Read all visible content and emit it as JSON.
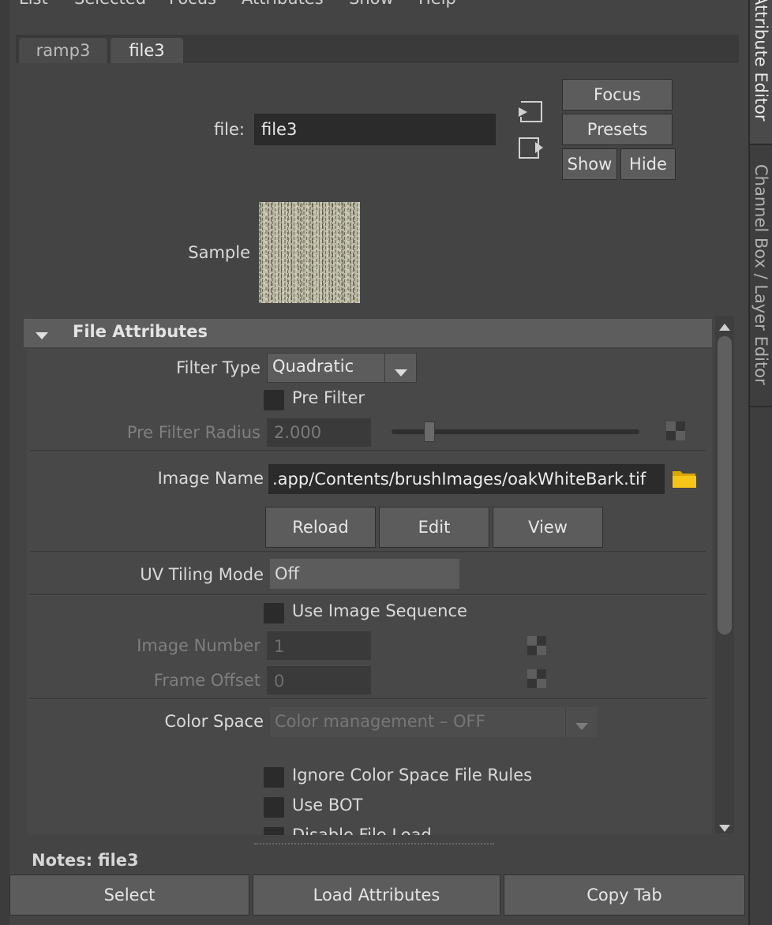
{
  "menubar": [
    "List",
    "Selected",
    "Focus",
    "Attributes",
    "Show",
    "Help"
  ],
  "tabs": [
    {
      "label": "ramp3",
      "active": false
    },
    {
      "label": "file3",
      "active": true
    }
  ],
  "node": {
    "label": "file:",
    "value": "file3"
  },
  "header_buttons": {
    "focus": "Focus",
    "presets": "Presets",
    "show": "Show",
    "hide": "Hide"
  },
  "sample_label": "Sample",
  "section": {
    "title": "File Attributes",
    "expanded": true
  },
  "attrs": {
    "filter_type": {
      "label": "Filter Type",
      "value": "Quadratic"
    },
    "pre_filter": {
      "label": "Pre Filter",
      "checked": false
    },
    "pre_filter_radius": {
      "label": "Pre Filter Radius",
      "value": "2.000",
      "slider_fraction": 0.13
    },
    "image_name": {
      "label": "Image Name",
      "value": ".app/Contents/brushImages/oakWhiteBark.tif"
    },
    "image_buttons": {
      "reload": "Reload",
      "edit": "Edit",
      "view": "View"
    },
    "uv_tiling": {
      "label": "UV Tiling Mode",
      "value": "Off"
    },
    "use_image_sequence": {
      "label": "Use Image Sequence",
      "checked": false
    },
    "image_number": {
      "label": "Image Number",
      "value": "1"
    },
    "frame_offset": {
      "label": "Frame Offset",
      "value": "0"
    },
    "color_space": {
      "label": "Color Space",
      "value": "Color management – OFF"
    },
    "ignore_cs_rules": {
      "label": "Ignore Color Space File Rules",
      "checked": false
    },
    "use_bot": {
      "label": "Use BOT",
      "checked": false
    },
    "disable_file_load": {
      "label": "Disable File Load",
      "checked": false
    }
  },
  "notes": {
    "label": "Notes:",
    "value": "file3"
  },
  "footer_buttons": {
    "select": "Select",
    "load": "Load Attributes",
    "copy": "Copy Tab"
  },
  "side_tabs": {
    "attribute_editor": "Attribute Editor",
    "channel_box": "Channel Box / Layer Editor"
  },
  "colors": {
    "background": "#444444",
    "field": "#2b2b2b",
    "button": "#5c5c5c",
    "section_header": "#5d5d5d",
    "folder_icon": "#f5c518"
  }
}
